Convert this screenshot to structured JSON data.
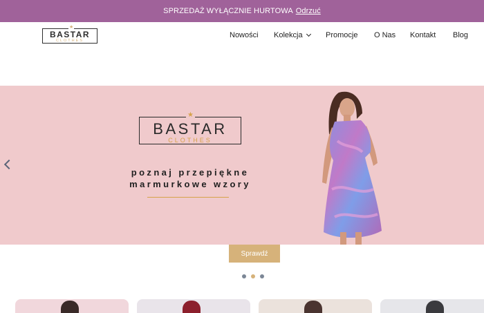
{
  "notice": {
    "text": "SPRZEDAŻ WYŁĄCZNIE HURTOWA",
    "dismiss_label": "Odrzuć"
  },
  "header": {
    "logo_brand": "BASTAR",
    "logo_sub": "CLOTHES",
    "nav": [
      {
        "label": "Nowości"
      },
      {
        "label": "Kolekcja",
        "has_dropdown": true
      },
      {
        "label": "Promocje"
      },
      {
        "label": "O Nas"
      },
      {
        "label": "Kontakt"
      },
      {
        "label": "Blog"
      }
    ]
  },
  "hero": {
    "logo_brand": "BASTAR",
    "logo_sub": "CLOTHES",
    "line1": "poznaj przepiękne",
    "line2": "marmurkowe wzory",
    "cta_label": "Sprawdź",
    "slides_count": 3,
    "active_slide": 1
  },
  "colors": {
    "notice_bg": "#a0629a",
    "hero_bg": "#f0cacc",
    "accent_gold": "#d6b27a",
    "text_dark": "#1f1f1f"
  },
  "icons": {
    "prev": "chevron-left-icon",
    "dropdown": "chevron-down-icon"
  }
}
